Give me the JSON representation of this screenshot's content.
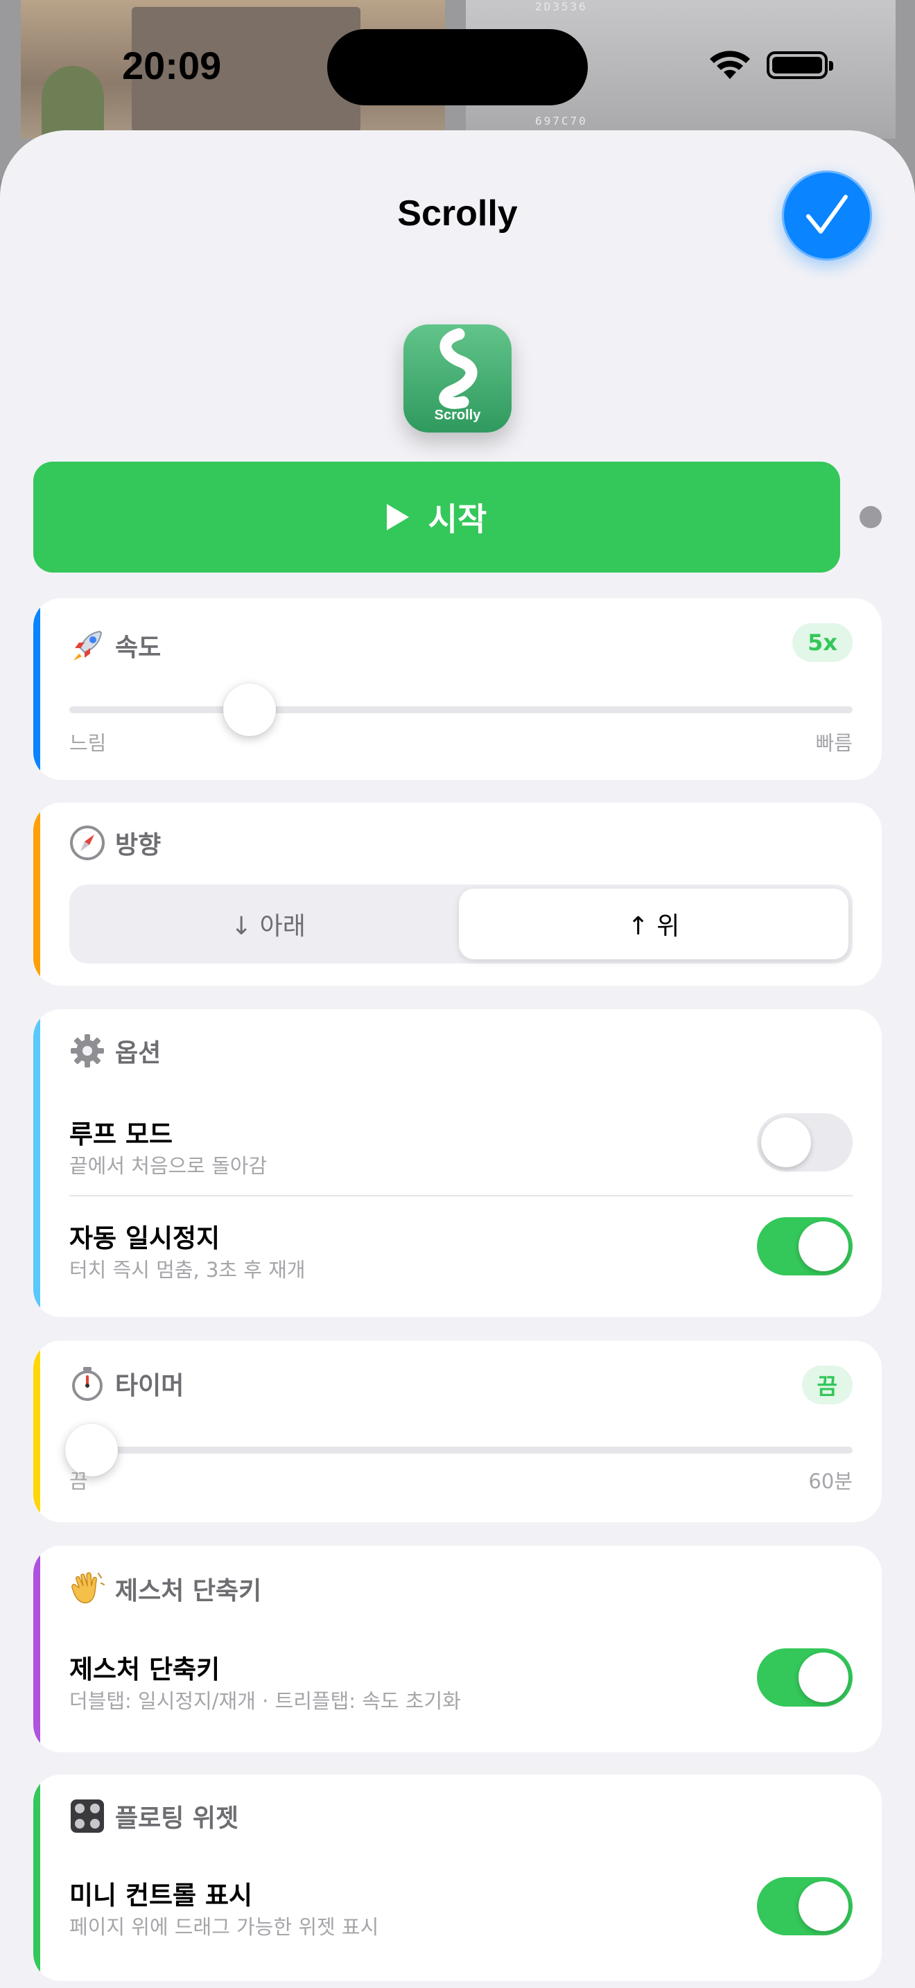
{
  "status": {
    "time": "20:09"
  },
  "background": {
    "code_top": "2D3536",
    "code_bottom": "697C70"
  },
  "sheet": {
    "title": "Scrolly"
  },
  "app_icon": {
    "label": "Scrolly"
  },
  "start_button": {
    "label": "시작"
  },
  "speed": {
    "title": "속도",
    "badge": "5x",
    "min_label": "느림",
    "max_label": "빠름",
    "value_fraction": 0.23
  },
  "direction": {
    "title": "방향",
    "down_label": "↓ 아래",
    "up_label": "↑ 위",
    "selected": "up"
  },
  "options": {
    "title": "옵션",
    "loop": {
      "title": "루프 모드",
      "subtitle": "끝에서 처음으로 돌아감",
      "on": false
    },
    "auto_pause": {
      "title": "자동 일시정지",
      "subtitle": "터치 즉시 멈춤, 3초 후 재개",
      "on": true
    }
  },
  "timer": {
    "title": "타이머",
    "badge": "끔",
    "min_label": "끔",
    "max_label": "60분",
    "value_fraction": 0.0
  },
  "gesture": {
    "title": "제스처 단축키",
    "item_title": "제스처 단축키",
    "item_subtitle": "더블탭: 일시정지/재개 · 트리플탭: 속도 초기화",
    "on": true
  },
  "floating": {
    "title": "플로팅 위젯",
    "item_title": "미니 컨트롤 표시",
    "item_subtitle": "페이지 위에 드래그 가능한 위젯 표시",
    "on": true
  },
  "colors": {
    "accent_blue": "#0a84ff",
    "accent_green": "#34c759",
    "speed_bar": "#0a84ff",
    "direction_bar": "#ff9f0a",
    "options_bar": "#5ac8fa",
    "timer_bar": "#ffd60a",
    "gesture_bar": "#af52de",
    "floating_bar": "#34c759"
  },
  "icons": {
    "done": "checkmark-icon",
    "speed": "rocket-icon",
    "direction": "compass-icon",
    "options": "gear-icon",
    "timer": "stopwatch-icon",
    "gesture": "waving-hand-icon",
    "floating": "control-knobs-icon"
  }
}
